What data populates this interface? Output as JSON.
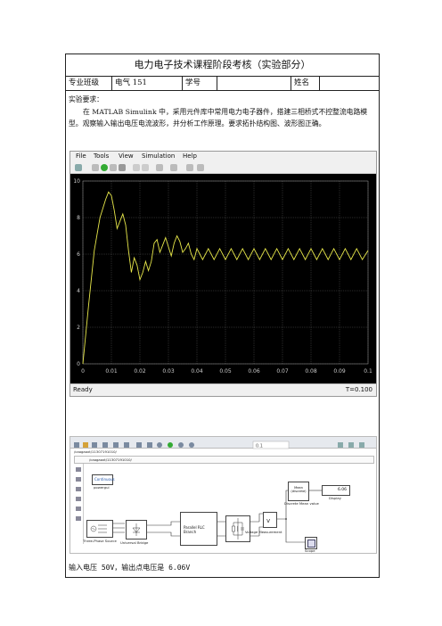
{
  "title": "电力电子技术课程阶段考核（实验部分）",
  "info": {
    "major_label": "专业班级",
    "major_value": "电气 151",
    "id_label": "学号",
    "name_label": "姓名"
  },
  "requirements": {
    "heading": "实验要求：",
    "body": "在 MATLAB Simulink 中，采用元件库中常用电力电子器件，搭建三相桥式不控整流电路模型。观察输入输出电压电流波形，并分析工作原理。要求拓扑结构图、波形图正确。"
  },
  "scope": {
    "menu": [
      "File",
      "Tools",
      "View",
      "Simulation",
      "Help"
    ],
    "status_left": "Ready",
    "status_right": "T=0.100",
    "trace_color": "#e8e84a"
  },
  "chart_data": {
    "type": "line",
    "xlim": [
      0,
      0.1
    ],
    "ylim": [
      0,
      10
    ],
    "xticks": [
      "0",
      "0.01",
      "0.02",
      "0.03",
      "0.04",
      "0.05",
      "0.06",
      "0.07",
      "0.08",
      "0.09",
      "0.1"
    ],
    "yticks": [
      "0",
      "2",
      "4",
      "6",
      "8",
      "10"
    ],
    "grid": true,
    "series": [
      {
        "x": [
          0,
          0.002,
          0.004,
          0.006,
          0.008,
          0.009,
          0.01,
          0.011,
          0.012,
          0.013,
          0.014,
          0.015,
          0.016,
          0.017,
          0.018,
          0.019,
          0.02,
          0.021,
          0.022,
          0.023,
          0.024,
          0.025,
          0.026,
          0.027,
          0.028,
          0.029,
          0.03,
          0.031,
          0.032,
          0.033,
          0.034,
          0.035,
          0.036,
          0.037,
          0.038,
          0.039,
          0.04,
          0.042,
          0.044,
          0.046,
          0.048,
          0.05,
          0.052,
          0.054,
          0.056,
          0.058,
          0.06,
          0.062,
          0.064,
          0.066,
          0.068,
          0.07,
          0.072,
          0.074,
          0.076,
          0.078,
          0.08,
          0.082,
          0.084,
          0.086,
          0.088,
          0.09,
          0.092,
          0.094,
          0.096,
          0.098,
          0.1
        ],
        "y": [
          0,
          3.2,
          6.2,
          8.0,
          9.0,
          9.4,
          9.2,
          8.4,
          7.4,
          7.8,
          8.2,
          7.6,
          6.2,
          5.0,
          5.8,
          5.4,
          4.6,
          5.0,
          5.6,
          5.1,
          5.6,
          6.6,
          6.8,
          6.1,
          6.5,
          6.9,
          6.4,
          5.9,
          6.6,
          7.0,
          6.7,
          6.1,
          6.3,
          6.6,
          6.0,
          5.7,
          6.3,
          5.7,
          6.3,
          5.7,
          6.3,
          5.7,
          6.3,
          5.7,
          6.3,
          5.7,
          6.3,
          5.7,
          6.3,
          5.7,
          6.3,
          5.7,
          6.3,
          5.7,
          6.3,
          5.7,
          6.3,
          5.7,
          6.3,
          5.7,
          6.3,
          5.7,
          6.3,
          5.7,
          6.3,
          5.7,
          6.2
        ]
      }
    ]
  },
  "model": {
    "path": "/caogaoxt/11307191010/",
    "blocks": {
      "powergui": "powergui",
      "continuous": "Continuous",
      "source": "Three-Phase Source",
      "bridge": "Universal Bridge",
      "rlc": "Parallel RLC Branch",
      "vm": "Voltage Measurement",
      "mean": "Mean (discrete)",
      "mean_label": "Discrete Mean value",
      "display": "Display",
      "display_value": "6.06",
      "scope": "Scope"
    }
  },
  "result": "输入电压 50V，输出点电压是 6.06V"
}
